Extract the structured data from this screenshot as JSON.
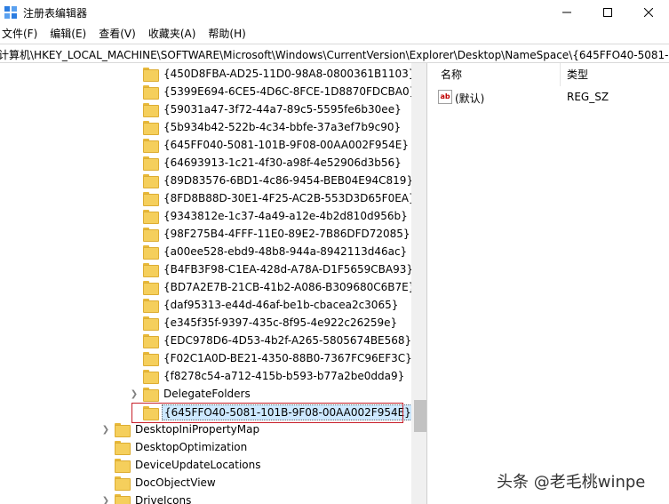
{
  "window": {
    "title": "注册表编辑器",
    "icon": "regedit-icon"
  },
  "menu": [
    "文件(F)",
    "编辑(E)",
    "查看(V)",
    "收藏夹(A)",
    "帮助(H)"
  ],
  "address": "计算机\\HKEY_LOCAL_MACHINE\\SOFTWARE\\Microsoft\\Windows\\CurrentVersion\\Explorer\\Desktop\\NameSpace\\{645FFO40-5081-10",
  "tree": {
    "guid_items": [
      "{450D8FBA-AD25-11D0-98A8-0800361B1103}",
      "{5399E694-6CE5-4D6C-8FCE-1D8870FDCBA0}",
      "{59031a47-3f72-44a7-89c5-5595fe6b30ee}",
      "{5b934b42-522b-4c34-bbfe-37a3ef7b9c90}",
      "{645FF040-5081-101B-9F08-00AA002F954E}",
      "{64693913-1c21-4f30-a98f-4e52906d3b56}",
      "{89D83576-6BD1-4c86-9454-BEB04E94C819}",
      "{8FD8B88D-30E1-4F25-AC2B-553D3D65F0EA}",
      "{9343812e-1c37-4a49-a12e-4b2d810d956b}",
      "{98F275B4-4FFF-11E0-89E2-7B86DFD72085}",
      "{a00ee528-ebd9-48b8-944a-8942113d46ac}",
      "{B4FB3F98-C1EA-428d-A78A-D1F5659CBA93}",
      "{BD7A2E7B-21CB-41b2-A086-B309680C6B7E}",
      "{daf95313-e44d-46af-be1b-cbacea2c3065}",
      "{e345f35f-9397-435c-8f95-4e922c26259e}",
      "{EDC978D6-4D53-4b2f-A265-5805674BE568}",
      "{F02C1A0D-BE21-4350-88B0-7367FC96EF3C}",
      "{f8278c54-a712-415b-b593-b77a2be0dda9}"
    ],
    "delegate_folders": "DelegateFolders",
    "selected": "{645FFO40-5081-101B-9F08-00AA002F954E}",
    "siblings": [
      "DesktopIniPropertyMap",
      "DesktopOptimization",
      "DeviceUpdateLocations",
      "DocObjectView",
      "DriveIcons"
    ]
  },
  "list": {
    "col_name": "名称",
    "col_type": "类型",
    "rows": [
      {
        "name": "(默认)",
        "type": "REG_SZ",
        "icon": "ab"
      }
    ]
  },
  "watermark": "头条 @老毛桃winpe"
}
